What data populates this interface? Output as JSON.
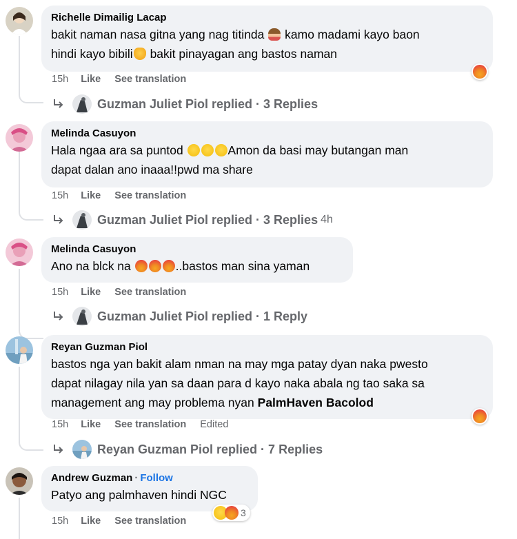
{
  "comments": [
    {
      "author": "Richelle Dimailig Lacap",
      "line1": "bakit naman nasa gitna yang nag titinda",
      "line1b": "kamo madami kayo baon",
      "line2": "hindi kayo bibili",
      "line2b": "bakit pinayagan ang bastos naman",
      "time": "15h",
      "like": "Like",
      "see_translation": "See translation",
      "reply_text": "Guzman Juliet Piol replied · 3 Replies",
      "reaction_icon": "angry-icon"
    },
    {
      "author": "Melinda Casuyon",
      "line1": "Hala ngaa ara sa puntod",
      "line1b": "Amon da basi may butangan man",
      "line2": "dapat dalan ano inaaa!!pwd ma share",
      "time": "15h",
      "like": "Like",
      "see_translation": "See translation",
      "reply_text": "Guzman Juliet Piol replied · 3 Replies",
      "reply_time": "4h"
    },
    {
      "author": "Melinda Casuyon",
      "line1": "Ano na blck na",
      "line1b": "..bastos man sina yaman",
      "time": "15h",
      "like": "Like",
      "see_translation": "See translation",
      "reply_text": "Guzman Juliet Piol replied · 1 Reply"
    },
    {
      "author": "Reyan Guzman Piol",
      "line1": "bastos nga yan bakit alam nman na may mga patay dyan naka pwesto",
      "line2": "dapat nilagay nila yan sa daan para d kayo naka abala ng tao saka sa",
      "line3": "management ang may problema nyan",
      "mention": "PalmHaven Bacolod",
      "time": "15h",
      "like": "Like",
      "see_translation": "See translation",
      "edited": "Edited",
      "reply_text": "Reyan Guzman Piol replied · 7 Replies",
      "reaction_icon": "angry-icon"
    },
    {
      "author": "Andrew Guzman",
      "follow": "Follow",
      "line1": "Patyo ang palmhaven hindi NGC",
      "time": "15h",
      "like": "Like",
      "see_translation": "See translation",
      "reaction_count": "3",
      "reaction_icons": [
        "grinning-sweat-icon",
        "angry-icon"
      ]
    }
  ],
  "colors": {
    "bubble": "#f0f2f5",
    "meta": "#65676b",
    "link_blue": "#1b74e4"
  }
}
